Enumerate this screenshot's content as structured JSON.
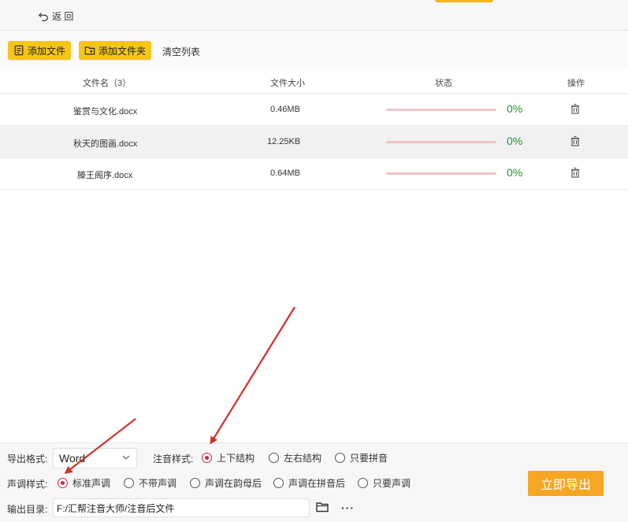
{
  "header": {
    "back_label": "返 回"
  },
  "toolbar": {
    "add_file_label": "添加文件",
    "add_folder_label": "添加文件夹",
    "clear_list_label": "清空列表"
  },
  "table": {
    "columns": {
      "name": "文件名（3）",
      "size": "文件大小",
      "status": "状态",
      "action": "操作"
    },
    "rows": [
      {
        "name": "鉴赏与文化.docx",
        "size": "0.46MB",
        "progress_pct": "0%",
        "progress": 0
      },
      {
        "name": "秋天的图画.docx",
        "size": "12.25KB",
        "progress_pct": "0%",
        "progress": 0
      },
      {
        "name": "滕王阁序.docx",
        "size": "0.64MB",
        "progress_pct": "0%",
        "progress": 0
      }
    ]
  },
  "settings": {
    "export_format_label": "导出格式:",
    "export_format_value": "Word",
    "annotation_style_label": "注音样式:",
    "annotation_options": [
      "上下结构",
      "左右结构",
      "只要拼音"
    ],
    "annotation_selected": "上下结构",
    "tone_style_label": "声调样式:",
    "tone_options": [
      "标准声调",
      "不带声调",
      "声调在韵母后",
      "声调在拼音后",
      "只要声调"
    ],
    "tone_selected": "标准声调",
    "output_dir_label": "输出目录:",
    "output_dir_value": "F:/汇帮注音大师/注音后文件",
    "more_label": "···",
    "export_button_label": "立即导出"
  },
  "colors": {
    "accent_yellow": "#f5c518",
    "export_orange": "#f5a623",
    "progress_track": "#efc3c9",
    "percent_green": "#1b9a2b",
    "radio_selected": "#d6224b",
    "annotation_arrow": "#d0312d"
  },
  "icons": {
    "back": "back-arrow-icon",
    "add_file": "file-add-icon",
    "add_folder": "folder-add-icon",
    "delete": "trash-icon",
    "dropdown": "chevron-down-icon",
    "browse": "folder-icon",
    "more": "more-icon"
  }
}
